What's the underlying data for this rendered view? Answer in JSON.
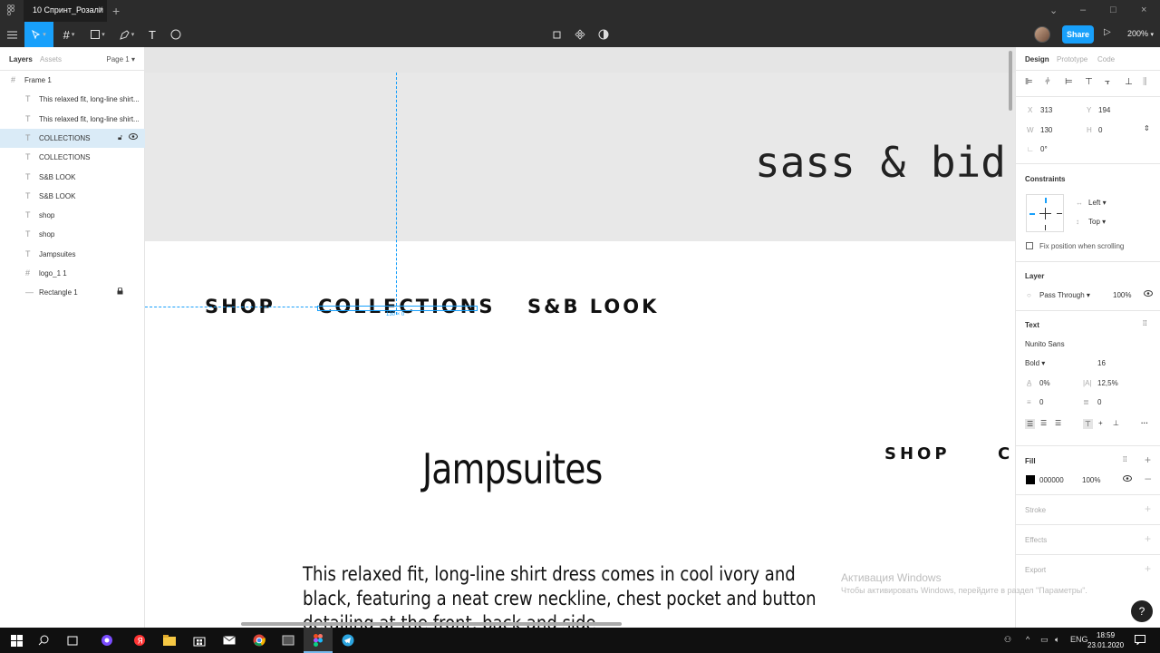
{
  "titlebar": {
    "tab_title": "10 Спринт_Розали",
    "tab_close": "×",
    "new_tab": "+",
    "minimize": "–",
    "maximize": "□",
    "close": "×",
    "chevron": "⌄"
  },
  "toolbar": {
    "share_label": "Share",
    "zoom_label": "200%"
  },
  "left_panel": {
    "tabs": [
      "Layers",
      "Assets"
    ],
    "page_label": "Page 1",
    "layers": [
      {
        "icon": "#",
        "name": "Frame 1",
        "indent": 0,
        "type": "frame"
      },
      {
        "icon": "T",
        "name": "This relaxed fit, long-line shirt...",
        "indent": 1,
        "type": "text"
      },
      {
        "icon": "T",
        "name": "This relaxed fit, long-line shirt...",
        "indent": 1,
        "type": "text"
      },
      {
        "icon": "T",
        "name": "COLLECTIONS",
        "indent": 1,
        "type": "text",
        "selected": true
      },
      {
        "icon": "T",
        "name": "COLLECTIONS",
        "indent": 1,
        "type": "text"
      },
      {
        "icon": "T",
        "name": "S&B LOOK",
        "indent": 1,
        "type": "text"
      },
      {
        "icon": "T",
        "name": "S&B LOOK",
        "indent": 1,
        "type": "text"
      },
      {
        "icon": "T",
        "name": "shop",
        "indent": 1,
        "type": "text"
      },
      {
        "icon": "T",
        "name": "shop",
        "indent": 1,
        "type": "text"
      },
      {
        "icon": "T",
        "name": "Jampsuites",
        "indent": 1,
        "type": "text"
      },
      {
        "icon": "#",
        "name": "logo_1 1",
        "indent": 1,
        "type": "frame"
      },
      {
        "icon": "—",
        "name": "Rectangle 1",
        "indent": 1,
        "type": "rect",
        "locked": true
      }
    ]
  },
  "canvas": {
    "logo_text": "sass & bid",
    "nav_primary": [
      "SHOP",
      "COLLECTIONS",
      "S&B LOOK"
    ],
    "nav_secondary": [
      "SHOP",
      "C"
    ],
    "heading": "Jampsuites",
    "body_text": "This relaxed fit, long-line shirt dress comes in cool ivory and black, featuring a neat crew neckline, chest pocket and button detailing at the front, back and side",
    "selection_label": "130 × 0"
  },
  "right_panel": {
    "tabs": [
      "Design",
      "Prototype",
      "Code"
    ],
    "x_label": "X",
    "x_value": "313",
    "y_label": "Y",
    "y_value": "194",
    "w_label": "W",
    "w_value": "130",
    "h_label": "H",
    "h_value": "0",
    "rotation_value": "0°",
    "constraints_title": "Constraints",
    "constraint_h": "Left",
    "constraint_v": "Top",
    "fix_position_label": "Fix position when scrolling",
    "layer_title": "Layer",
    "blend_mode": "Pass Through",
    "layer_opacity": "100%",
    "text_title": "Text",
    "font_family": "Nunito Sans",
    "font_weight": "Bold",
    "font_size": "16",
    "letter_spacing": "0%",
    "line_height": "12,5%",
    "paragraph_spacing": "0",
    "paragraph_indent": "0",
    "fill_title": "Fill",
    "fill_hex": "000000",
    "fill_opacity": "100%",
    "stroke_title": "Stroke",
    "effects_title": "Effects",
    "export_title": "Export"
  },
  "watermark": {
    "title": "Активация Windows",
    "subtitle": "Чтобы активировать Windows, перейдите в раздел \"Параметры\"."
  },
  "help_label": "?",
  "taskbar": {
    "language": "ENG",
    "time": "18:59",
    "date": "23.01.2020"
  },
  "colors": {
    "accent": "#18a0fb",
    "selected_layer": "#daebf7",
    "toolbar_bg": "#2c2c2c"
  }
}
